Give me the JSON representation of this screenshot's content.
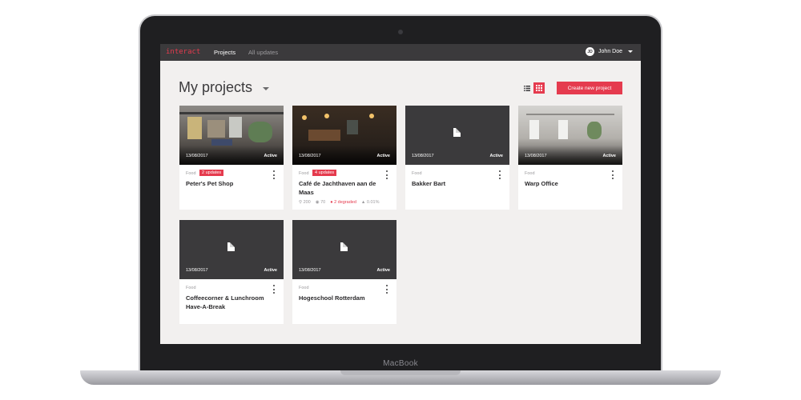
{
  "device": {
    "brand": "MacBook"
  },
  "topbar": {
    "logo": "interact",
    "nav": [
      "Projects",
      "All updates"
    ],
    "user": {
      "initials": "JD",
      "name": "John Doe"
    }
  },
  "page": {
    "title": "My projects",
    "create_button": "Create new project",
    "view_mode": "grid"
  },
  "colors": {
    "accent": "#e53b4e",
    "topbar": "#3b3a3c",
    "background": "#f2f0ef"
  },
  "projects": [
    {
      "date": "13/08/2017",
      "status": "Active",
      "category": "Food",
      "badge": "2 updates",
      "title": "Peter's Pet Shop",
      "image": "photo"
    },
    {
      "date": "13/08/2017",
      "status": "Active",
      "category": "Food",
      "badge": "4 updates",
      "title": "Café de Jachthaven aan de Maas",
      "image": "photo",
      "stats": {
        "devices": "200",
        "sensors": "70",
        "degraded": "2 degraded",
        "percent": "0.01%"
      }
    },
    {
      "date": "13/08/2017",
      "status": "Active",
      "category": "Food",
      "title": "Bakker Bart",
      "image": "placeholder"
    },
    {
      "date": "13/08/2017",
      "status": "Active",
      "category": "Food",
      "title": "Warp Office",
      "image": "photo"
    },
    {
      "date": "13/08/2017",
      "status": "Active",
      "category": "Food",
      "title": "Coffeecorner & Lunchroom Have-A-Break",
      "image": "placeholder"
    },
    {
      "date": "13/08/2017",
      "status": "Active",
      "category": "Food",
      "title": "Hogeschool Rotterdam",
      "image": "placeholder"
    }
  ]
}
